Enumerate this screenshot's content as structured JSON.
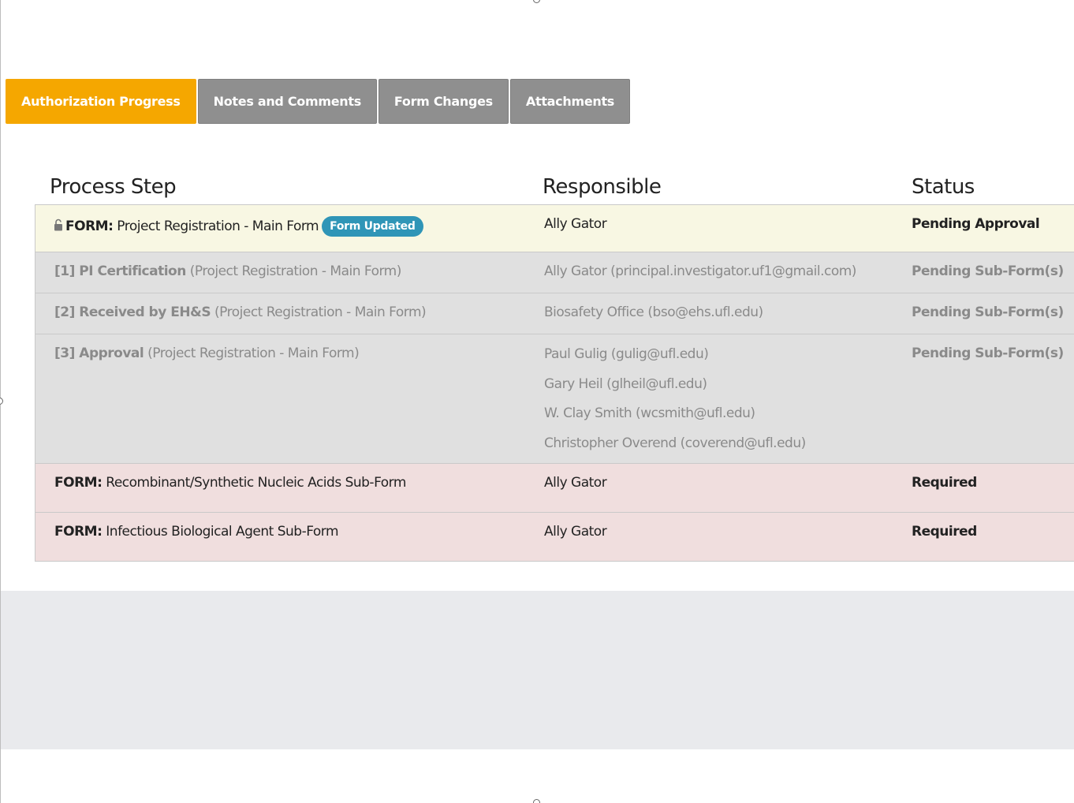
{
  "tabs": [
    {
      "label": "Authorization Progress",
      "active": true
    },
    {
      "label": "Notes and Comments",
      "active": false
    },
    {
      "label": "Form Changes",
      "active": false
    },
    {
      "label": "Attachments",
      "active": false
    }
  ],
  "table": {
    "headers": {
      "step": "Process Step",
      "responsible": "Responsible",
      "status": "Status"
    },
    "rows": [
      {
        "prefix": "FORM:",
        "name": "Project Registration - Main Form",
        "badge": "Form Updated",
        "responsible": "Ally Gator",
        "status": "Pending Approval",
        "icon": "lock-open-icon"
      },
      {
        "prefix": "[1] PI Certification",
        "name": "(Project Registration - Main Form)",
        "responsible": "Ally Gator (principal.investigator.uf1@gmail.com)",
        "status": "Pending Sub-Form(s)"
      },
      {
        "prefix": "[2] Received by EH&S",
        "name": "(Project Registration - Main Form)",
        "responsible": "Biosafety Office (bso@ehs.ufl.edu)",
        "status": "Pending Sub-Form(s)"
      },
      {
        "prefix": "[3] Approval",
        "name": "(Project Registration - Main Form)",
        "responsible_list": [
          "Paul Gulig (gulig@ufl.edu)",
          "Gary Heil (glheil@ufl.edu)",
          "W. Clay Smith (wcsmith@ufl.edu)",
          "Christopher Overend (coverend@ufl.edu)"
        ],
        "status": "Pending Sub-Form(s)"
      },
      {
        "prefix": "FORM:",
        "name": "Recombinant/Synthetic Nucleic Acids Sub-Form",
        "responsible": "Ally Gator",
        "status": "Required"
      },
      {
        "prefix": "FORM:",
        "name": "Infectious Biological Agent Sub-Form",
        "responsible": "Ally Gator",
        "status": "Required"
      }
    ]
  },
  "colors": {
    "tab_active": "#f5a700",
    "tab_inactive": "#8f8f8f",
    "badge": "#2f95b7",
    "row_current": "#f8f7e3",
    "row_pending": "#e0e0e0",
    "row_required": "#f0dede"
  }
}
